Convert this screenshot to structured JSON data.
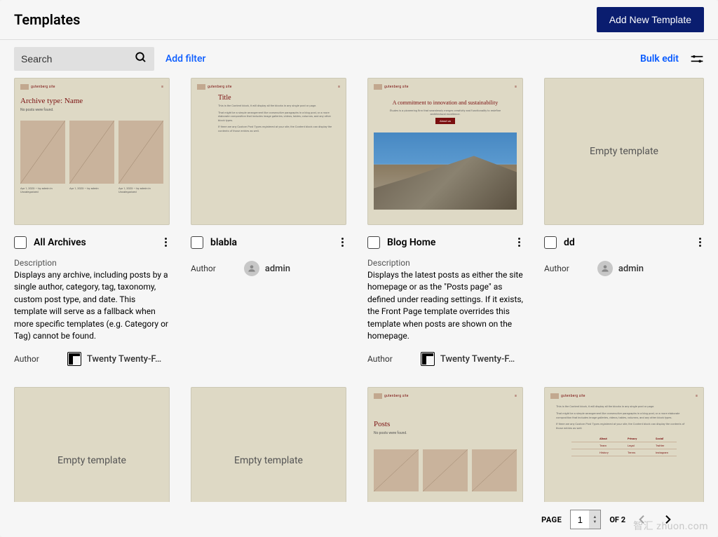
{
  "header": {
    "title": "Templates",
    "add_button": "Add New Template"
  },
  "toolbar": {
    "search_placeholder": "Search",
    "add_filter": "Add filter",
    "bulk_edit": "Bulk edit"
  },
  "labels": {
    "description": "Description",
    "author": "Author",
    "empty_template": "Empty template"
  },
  "preview_text": {
    "site_name": "gutenberg site",
    "archive_title": "Archive type: Name",
    "archive_sub": "No posts were found.",
    "single_title": "Title",
    "single_l1": "This is the Content block, it will display all the blocks in any single post or page.",
    "single_l2": "That might be a simple arrangement like consecutive paragraphs in a blog post, or a more elaborate composition that includes image galleries, videos, tables, columns, and any other block types.",
    "single_l3": "If there are any Custom Post Types registered at your site, the Content block can display the contents of those entries as well.",
    "blog_title": "A commitment to innovation and sustainability",
    "blog_sub": "Études is a pioneering firm that seamlessly merges creativity and functionality to redefine architectural excellence.",
    "blog_btn": "About us",
    "posts_title": "Posts",
    "posts_sub": "No posts were found."
  },
  "templates": [
    {
      "name": "All Archives",
      "description": "Displays any archive, including posts by a single author, category, tag, taxonomy, custom post type, and date. This template will serve as a fallback when more specific templates (e.g. Category or Tag) cannot be found.",
      "author_type": "theme",
      "author": "Twenty Twenty-F…",
      "preview": "archive"
    },
    {
      "name": "blabla",
      "description": null,
      "author_type": "user",
      "author": "admin",
      "preview": "single"
    },
    {
      "name": "Blog Home",
      "description": "Displays the latest posts as either the site homepage or as the \"Posts page\" as defined under reading settings. If it exists, the Front Page template overrides this template when posts are shown on the homepage.",
      "author_type": "theme",
      "author": "Twenty Twenty-F…",
      "preview": "blog"
    },
    {
      "name": "dd",
      "description": null,
      "author_type": "user",
      "author": "admin",
      "preview": "empty"
    },
    {
      "name": "",
      "preview": "empty"
    },
    {
      "name": "",
      "preview": "empty"
    },
    {
      "name": "",
      "preview": "posts"
    },
    {
      "name": "",
      "preview": "table"
    }
  ],
  "pagination": {
    "page_label": "PAGE",
    "current": "1",
    "of_label": "OF",
    "total": "2"
  },
  "watermark": "智汇 zhuon.com"
}
